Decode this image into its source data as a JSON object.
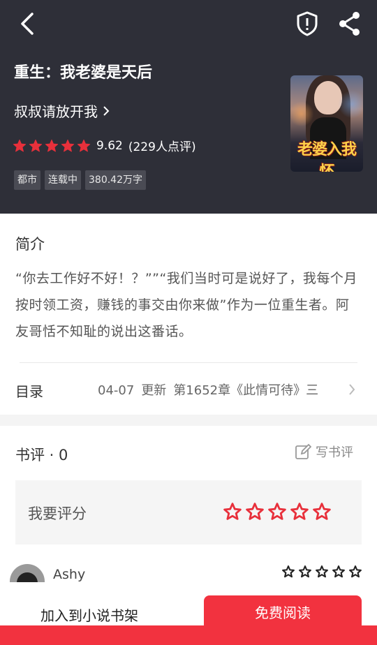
{
  "header": {
    "book_title": "重生：我老婆是天后",
    "author": "叔叔请放开我",
    "rating_score": "9.62",
    "rating_count": "(229人点评)",
    "rating_stars": 5,
    "tags": [
      "都市",
      "连载中",
      "380.42万字"
    ],
    "cover_text": "老婆入我怀",
    "bg_color": "#2e2f38"
  },
  "intro": {
    "title": "简介",
    "text": "“你去工作好不好！？””“我们当时可是说好了，我每个月按时领工资，赚钱的事交由你来做”作为一位重生者。阿友哥恬不知耻的说出这番话。"
  },
  "toc": {
    "label": "目录",
    "date": "04-07",
    "update": "更新",
    "chapter": "第1652章《此情可待》三"
  },
  "reviews": {
    "title": "书评 · 0",
    "write_label": "写书评",
    "rate_label": "我要评分",
    "rate_stars": 5
  },
  "comment": {
    "user": "Ashy",
    "stars": 5
  },
  "bottom": {
    "shelf_label": "加入到小说书架",
    "read_label": "免费阅读"
  },
  "colors": {
    "accent": "#f2323f",
    "star": "#e8303b"
  }
}
